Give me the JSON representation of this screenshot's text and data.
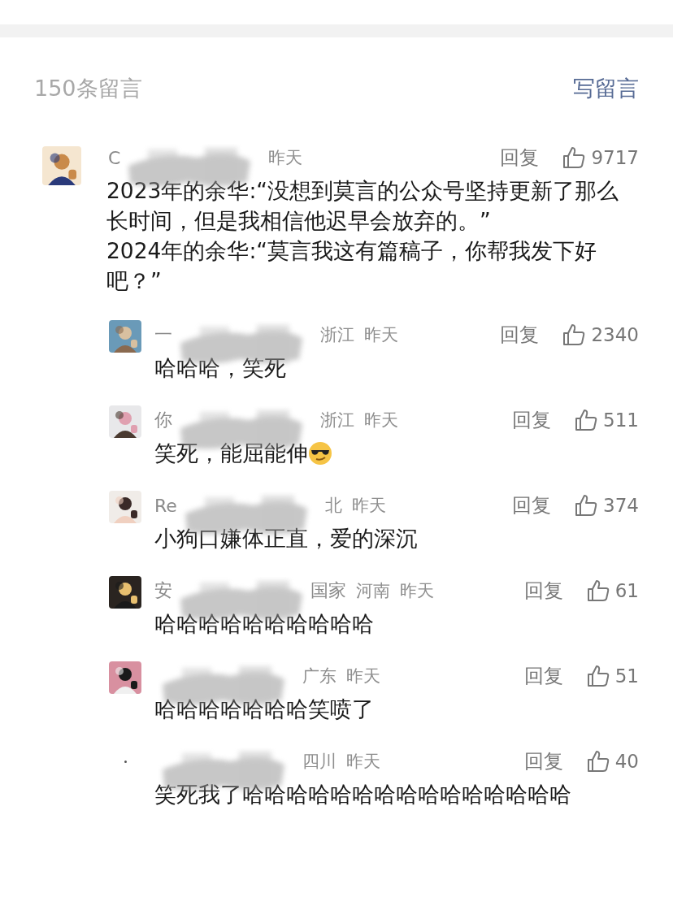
{
  "header": {
    "count": "150条留言",
    "write_link": "写留言"
  },
  "comments": [
    {
      "kind": "top",
      "avatar_loaded": true,
      "name": "C",
      "time": "昨天",
      "reply": "回复",
      "likes": "9717",
      "text": "2023年的余华:“没想到莫言的公众号坚持更新了那么长时间，但是我相信他迟早会放弃的。”\n2024年的余华:“莫言我这有篇稿子，你帮我发下好吧？”"
    },
    {
      "kind": "reply",
      "avatar_loaded": true,
      "name": "一",
      "location": "浙江",
      "time": "昨天",
      "reply": "回复",
      "likes": "2340",
      "text": "哈哈哈，笑死"
    },
    {
      "kind": "reply",
      "avatar_loaded": true,
      "name": "你",
      "location": "浙江",
      "time": "昨天",
      "reply": "回复",
      "likes": "511",
      "text": "笑死，能屈能伸",
      "has_emoji": true
    },
    {
      "kind": "reply",
      "avatar_loaded": true,
      "name": "Re",
      "location": "北",
      "time": "昨天",
      "reply": "回复",
      "likes": "374",
      "text": "小狗口嫌体正直，爱的深沉"
    },
    {
      "kind": "reply",
      "avatar_loaded": true,
      "name": "安",
      "name_tail": "国家",
      "location": "河南",
      "time": "昨天",
      "reply": "回复",
      "likes": "61",
      "text": "哈哈哈哈哈哈哈哈哈哈"
    },
    {
      "kind": "reply",
      "avatar_loaded": true,
      "location": "广东",
      "time": "昨天",
      "reply": "回复",
      "likes": "51",
      "text": "哈哈哈哈哈哈哈笑喷了"
    },
    {
      "kind": "reply",
      "avatar_loaded": false,
      "location": "四川",
      "time": "昨天",
      "reply": "回复",
      "likes": "40",
      "text": "笑死我了哈哈哈哈哈哈哈哈哈哈哈哈哈哈哈"
    }
  ]
}
